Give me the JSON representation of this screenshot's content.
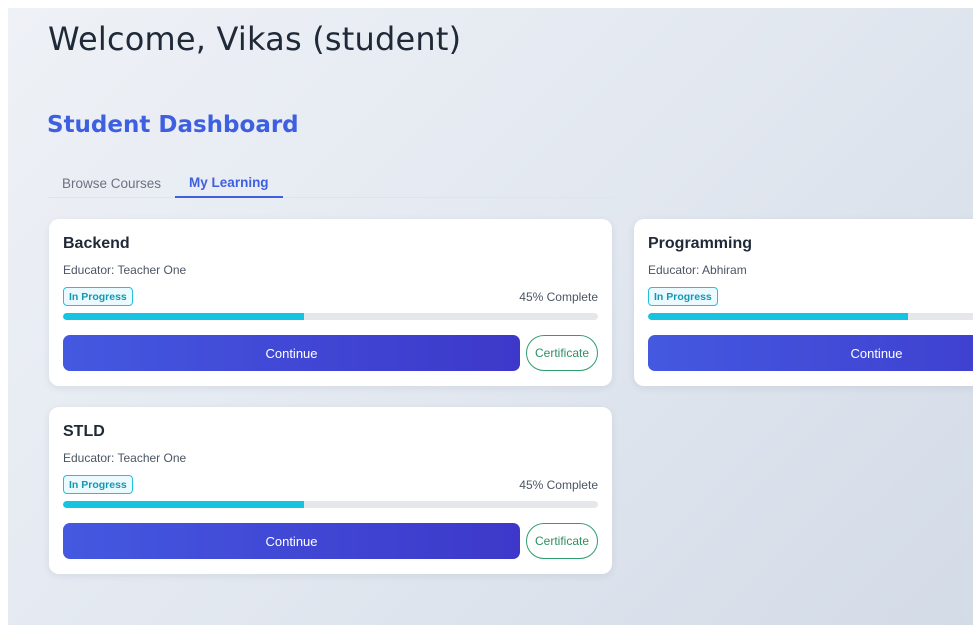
{
  "header": {
    "welcome": "Welcome, Vikas (student)",
    "dashboard_title": "Student Dashboard"
  },
  "tabs": [
    {
      "label": "Browse Courses",
      "active": false
    },
    {
      "label": "My Learning",
      "active": true
    }
  ],
  "courses": [
    {
      "title": "Backend",
      "educator": "Educator: Teacher One",
      "status": "In Progress",
      "progress_text": "45% Complete",
      "progress": 0.45,
      "continue_label": "Continue",
      "certificate_label": "Certificate"
    },
    {
      "title": "Programming",
      "educator": "Educator: Abhiram",
      "status": "In Progress",
      "progress": 0.75,
      "continue_label": "Continue"
    },
    {
      "title": "STLD",
      "educator": "Educator: Teacher One",
      "status": "In Progress",
      "progress_text": "45% Complete",
      "progress": 0.45,
      "continue_label": "Continue",
      "certificate_label": "Certificate"
    }
  ],
  "colors": {
    "accent": "#3e5fe0",
    "progress": "#16c3e0",
    "certificate": "#2f8f64"
  }
}
